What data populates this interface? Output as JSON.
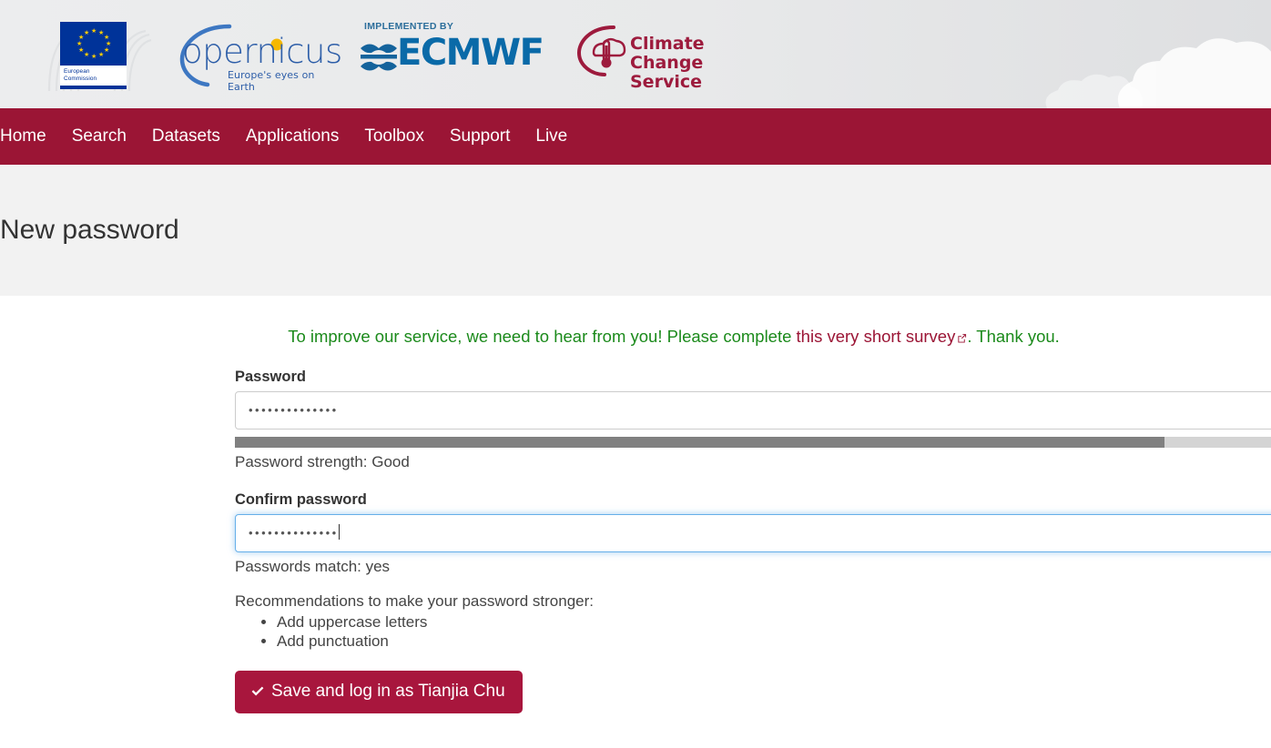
{
  "header": {
    "logos": [
      {
        "name": "european-commission-logo",
        "caption_line1": "European",
        "caption_line2": "Commission"
      },
      {
        "name": "copernicus-logo",
        "wordmark": "opernicus",
        "tagline": "Europe's eyes on Earth"
      },
      {
        "name": "ecmwf-logo",
        "implemented_by": "IMPLEMENTED BY",
        "wordmark": "ECMWF"
      },
      {
        "name": "climate-change-service-logo",
        "line1": "Climate Change",
        "line2": "Service"
      }
    ]
  },
  "nav": {
    "items": [
      {
        "label": "Home"
      },
      {
        "label": "Search"
      },
      {
        "label": "Datasets"
      },
      {
        "label": "Applications"
      },
      {
        "label": "Toolbox"
      },
      {
        "label": "Support"
      },
      {
        "label": "Live"
      }
    ]
  },
  "page": {
    "title": "New password"
  },
  "survey": {
    "text_before": "To improve our service, we need to hear from you! Please complete ",
    "link_text": "this very short survey",
    "link_icon": "external-link-icon",
    "text_after": ". Thank you."
  },
  "form": {
    "password": {
      "label": "Password",
      "value": "••••••••••••••",
      "placeholder": "",
      "focused": false
    },
    "strength": {
      "percent": 88,
      "text": "Password strength: Good",
      "fill_color": "#808080",
      "track_color": "#d4d4d4"
    },
    "confirm": {
      "label": "Confirm password",
      "value": "••••••••••••••",
      "placeholder": "",
      "focused": true
    },
    "match_text": "Passwords match: yes",
    "recommendations_title": "Recommendations to make your password stronger:",
    "recommendations": [
      "Add uppercase letters",
      "Add punctuation"
    ],
    "submit": {
      "icon": "check-icon",
      "label": "Save and log in as Tianjia Chu"
    }
  },
  "colors": {
    "brand_maroon": "#9b1535",
    "button_maroon": "#a8163d",
    "survey_green": "#1b8a1b",
    "focus_blue": "#66afe9",
    "title_band": "#f2f2f2"
  }
}
